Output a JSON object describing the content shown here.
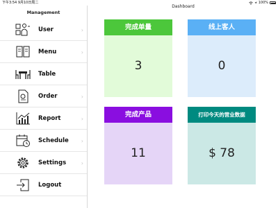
{
  "status": {
    "time_date": "下午3:54   9月10日周二",
    "battery": "100%"
  },
  "sidebar": {
    "title": "Management",
    "items": [
      {
        "label": "User",
        "icon": "user-icon"
      },
      {
        "label": "Menu",
        "icon": "menu-book-icon"
      },
      {
        "label": "Table",
        "icon": "table-icon"
      },
      {
        "label": "Order",
        "icon": "order-icon"
      },
      {
        "label": "Report",
        "icon": "report-chart-icon"
      },
      {
        "label": "Schedule",
        "icon": "schedule-icon"
      },
      {
        "label": "Settings",
        "icon": "gear-icon"
      },
      {
        "label": "Logout",
        "icon": "logout-icon"
      }
    ],
    "chevron": "›"
  },
  "main": {
    "title": "Dashboard",
    "cards": [
      {
        "title": "完成单量",
        "value": "3",
        "head_color": "#4cc73b",
        "body_color": "#e2fbd9"
      },
      {
        "title": "线上客人",
        "value": "0",
        "head_color": "#5ab0f5",
        "body_color": "#dcecfb"
      },
      {
        "title": "完成产品",
        "value": "11",
        "head_color": "#8a0ee0",
        "body_color": "#e5d5f7"
      },
      {
        "title": "打印今天的营业数据",
        "value": "$ 78",
        "head_color": "#008a80",
        "body_color": "#cbe8e5"
      }
    ]
  }
}
